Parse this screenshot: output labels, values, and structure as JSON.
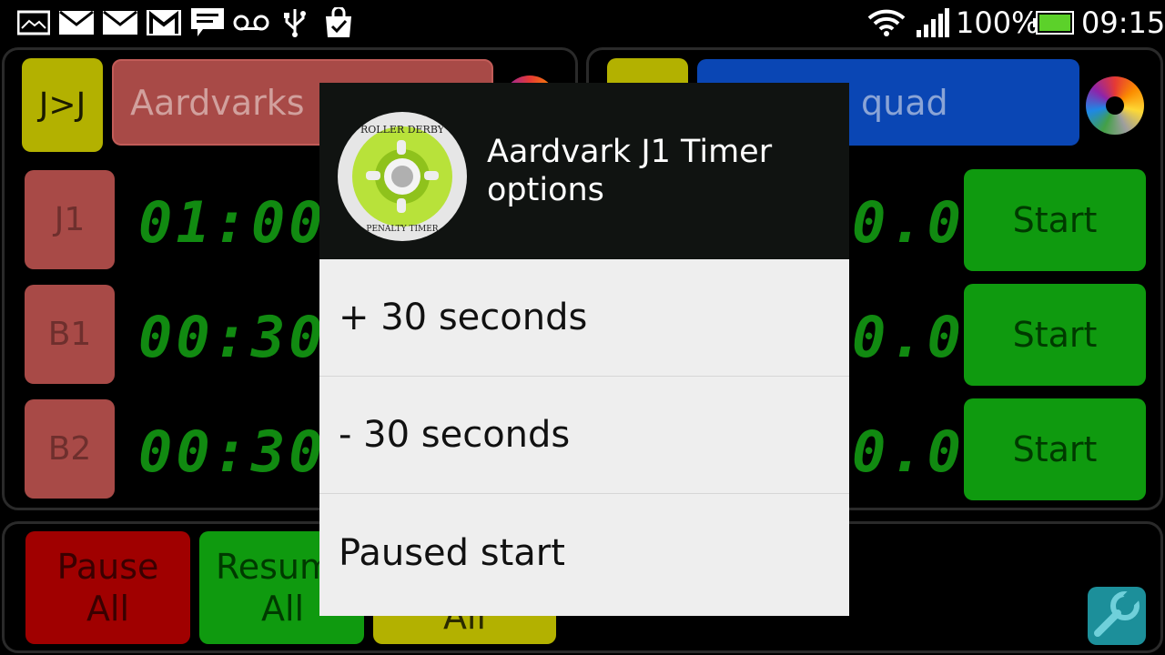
{
  "status_bar": {
    "battery": "100%",
    "time": "09:15",
    "notification_icons": [
      "image-icon",
      "mail-icon",
      "mail-icon",
      "gmail-icon",
      "message-icon",
      "voicemail-icon",
      "usb-icon",
      "shopping-bag-icon"
    ]
  },
  "home_team": {
    "swap_label": "J>J",
    "name": "Aardvarks",
    "color": "#a84a47",
    "rows": [
      {
        "label": "J1",
        "time": "01:00."
      },
      {
        "label": "B1",
        "time": "00:30."
      },
      {
        "label": "B2",
        "time": "00:30."
      }
    ]
  },
  "away_team": {
    "name": "quad",
    "color": "#0a46b4",
    "rows": [
      {
        "time": "0.0",
        "button": "Start"
      },
      {
        "time": "0.0",
        "button": "Start"
      },
      {
        "time": "0.0",
        "button": "Start"
      }
    ]
  },
  "bottom_bar": {
    "pause_all": [
      "Pause",
      "All"
    ],
    "resume_all": [
      "Resum",
      "All"
    ],
    "third_partial": "All"
  },
  "dialog": {
    "logo_text_top": "ROLLER DERBY",
    "logo_text_bottom": "PENALTY TIMER",
    "title": "Aardvark J1 Timer options",
    "options": [
      "+ 30 seconds",
      "- 30 seconds",
      "Paused start"
    ]
  }
}
